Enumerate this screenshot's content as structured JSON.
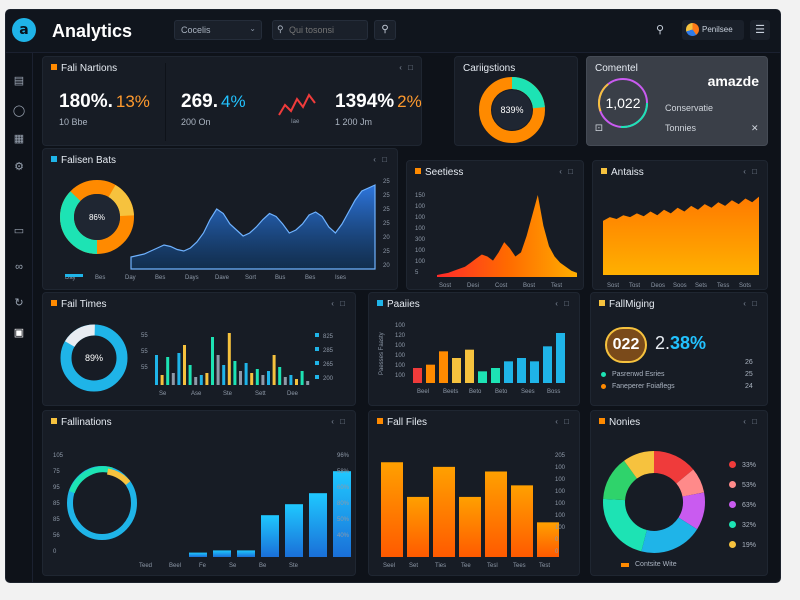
{
  "app": {
    "title": "Analytics",
    "logo_letter": "a"
  },
  "header": {
    "dropdown_label": "Cocelis",
    "search_placeholder": "Qui tosonsi",
    "profile_name": "Penilsee"
  },
  "icons": {
    "sidebar": [
      "wallet-icon",
      "support-icon",
      "document-icon",
      "settings-icon",
      "monitor-icon",
      "link-icon",
      "refresh-icon",
      "camera-icon"
    ],
    "topbar": [
      "search-icon",
      "menu-icon"
    ]
  },
  "colors": {
    "accent_blue": "#1fb4e8",
    "orange": "#ff8a00",
    "teal": "#1de3b4",
    "yellow": "#f6c23e",
    "red": "#ef3b3b",
    "bg": "#0e1219",
    "card": "#171c25"
  },
  "kpi": {
    "title": "Fali Nartions",
    "stats": [
      {
        "value": "180%.",
        "delta": "13%",
        "delta_color": "#ff9a2e",
        "sub": "10 Bbe"
      },
      {
        "value": "269.",
        "delta": "4%",
        "delta_color": "#22c2ff",
        "sub": "200 On"
      },
      {
        "value": "1394%",
        "delta": "2%",
        "delta_color": "#ff9a2e",
        "sub": "1 200 Jm"
      }
    ],
    "sparkline_label": "Iae"
  },
  "cards": {
    "categories": {
      "title": "Cariigstions",
      "donut_label": "839%"
    },
    "comments": {
      "title": "Comentel",
      "brand": "amazde",
      "ring_value": "1,022",
      "line1": "Conservatie",
      "line2": "Tonnies",
      "icon_left": "⚀",
      "icon_right": "✕"
    },
    "falsen_bats": {
      "title": "Falisen Bats",
      "donut_label": "86%",
      "x_labels": [
        "Day",
        "Bes",
        "Day",
        "Bes",
        "Days",
        "Dave",
        "Sort",
        "Bus",
        "Bes",
        "Ises"
      ],
      "y_labels": [
        "25",
        "25",
        "25",
        "25",
        "20",
        "25",
        "20"
      ]
    },
    "sectiess": {
      "title": "Seetiess",
      "x_labels": [
        "Sost",
        "Desi",
        "Cost",
        "Bost",
        "Test"
      ],
      "y_labels": [
        "150",
        "100",
        "100",
        "100",
        "300",
        "100",
        "100",
        "5"
      ]
    },
    "antaiss": {
      "title": "Antaiss",
      "x_labels": [
        "Sost",
        "Tost",
        "Deos",
        "Soos",
        "Sets",
        "Tess",
        "Sots"
      ]
    },
    "fail_times": {
      "title": "Fail Times",
      "donut_label": "89%",
      "x_labels": [
        "Se",
        "Ase",
        "Ste",
        "Sett",
        "Dee"
      ],
      "y_labels": [
        "55",
        "55",
        "55"
      ],
      "right_labels": [
        "825",
        "285",
        "265",
        "200"
      ]
    },
    "paaiies": {
      "title": "Paaiies",
      "x_labels": [
        "Beel",
        "Beets",
        "Beto",
        "Beto",
        "Sees",
        "Boss"
      ],
      "y_labels": [
        "100",
        "120",
        "100",
        "100",
        "100",
        "100"
      ],
      "side_label": "Paesses Faasty"
    },
    "fallmiging": {
      "title": "FallMiging",
      "ring_value": "022",
      "pct_prefix": "2.",
      "pct": "38%",
      "legend": [
        "Pasrenwd Esries",
        "Faneperer Foiaflegs"
      ],
      "right_labels": [
        "26",
        "25",
        "24"
      ]
    },
    "fallinations": {
      "title": "Fallinations",
      "x_labels": [
        "Teed",
        "Beel",
        "Fe",
        "Se",
        "Be",
        "Ste"
      ],
      "y_labels": [
        "105",
        "75",
        "95",
        "85",
        "85",
        "56",
        "0"
      ],
      "right_labels": [
        "96%",
        "58%",
        "60%",
        "80%",
        "50%",
        "40%"
      ]
    },
    "fall_files": {
      "title": "Fall Files",
      "x_labels": [
        "Seel",
        "Set",
        "Ties",
        "Tee",
        "Tesl",
        "Tees",
        "Test"
      ],
      "y_labels": [
        "205",
        "100",
        "100",
        "100",
        "100",
        "100",
        "100",
        "0",
        "0"
      ]
    },
    "nonies": {
      "title": "Nonies",
      "legend": [
        {
          "label": "33%",
          "color": "#ef3b3b"
        },
        {
          "label": "53%",
          "color": "#ff8a8a"
        },
        {
          "label": "63%",
          "color": "#c95bf0"
        },
        {
          "label": "32%",
          "color": "#1de3b4"
        },
        {
          "label": "19%",
          "color": "#f6c23e"
        }
      ],
      "footer": "Contsite Wite"
    }
  },
  "chart_data": [
    {
      "type": "area",
      "title": "Falisen Bats",
      "values": [
        8,
        9,
        10,
        12,
        14,
        16,
        15,
        13,
        12,
        14,
        18,
        24,
        33,
        40,
        37,
        30,
        26,
        22,
        24,
        28,
        33,
        37,
        35,
        30,
        24,
        26,
        30,
        36,
        38,
        35,
        28,
        24,
        30,
        38,
        46,
        52,
        54,
        56
      ]
    },
    {
      "type": "area",
      "title": "Seetiess",
      "values": [
        2,
        3,
        4,
        6,
        8,
        10,
        14,
        18,
        22,
        20,
        16,
        24,
        34,
        28,
        20,
        24,
        40,
        60,
        80,
        50,
        30,
        20,
        14,
        10,
        6,
        4
      ]
    },
    {
      "type": "area",
      "title": "Antaiss",
      "values": [
        58,
        62,
        60,
        64,
        62,
        66,
        63,
        68,
        64,
        70,
        66,
        72,
        68,
        74,
        70,
        76,
        72,
        78,
        74,
        80,
        76,
        82,
        78,
        84
      ]
    },
    {
      "type": "bar",
      "title": "Fail Times",
      "values": [
        30,
        10,
        28,
        12,
        32,
        40,
        20,
        8,
        10,
        12,
        48,
        30,
        20,
        52,
        24,
        14,
        22,
        12,
        16,
        10,
        14,
        30,
        18,
        8,
        10,
        6,
        14,
        4
      ]
    },
    {
      "type": "bar",
      "title": "Paaiies",
      "values": [
        18,
        22,
        38,
        30,
        40,
        14,
        18,
        26,
        30,
        26,
        44,
        60
      ],
      "colors": [
        "#ef3b3b",
        "#ff8a00",
        "#ff8a00",
        "#f6c23e",
        "#f6c23e",
        "#1de3b4",
        "#1de3b4",
        "#1fb4e8",
        "#1fb4e8",
        "#1fb4e8",
        "#1fb4e8",
        "#1fb4e8"
      ]
    },
    {
      "type": "bar",
      "title": "Fallinations",
      "values": [
        4,
        6,
        6,
        38,
        48,
        58,
        78
      ]
    },
    {
      "type": "bar",
      "title": "Fall Files",
      "values": [
        82,
        52,
        78,
        52,
        74,
        62,
        30
      ]
    },
    {
      "type": "pie",
      "title": "Nonies",
      "values": [
        14,
        8,
        12,
        20,
        22,
        14,
        10
      ],
      "colors": [
        "#ef3b3b",
        "#ff8a8a",
        "#c95bf0",
        "#1fb4e8",
        "#1de3b4",
        "#2fd36b",
        "#f6c23e"
      ]
    }
  ]
}
